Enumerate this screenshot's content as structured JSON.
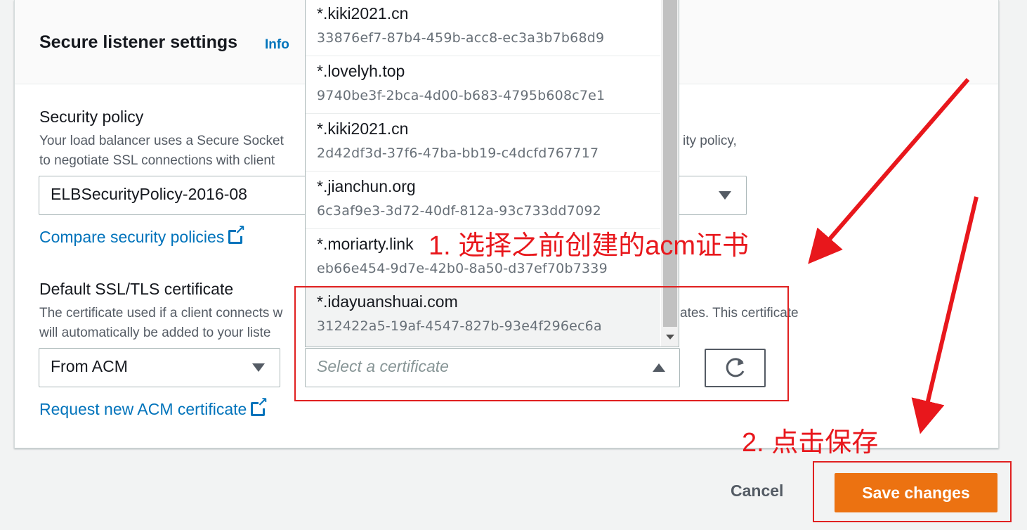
{
  "section": {
    "title": "Secure listener settings",
    "info_label": "Info"
  },
  "security_policy": {
    "label": "Security policy",
    "desc_line1": "Your load balancer uses a Secure Socket",
    "desc_line1_tail": "ity policy,",
    "desc_line2": "to negotiate SSL connections with client",
    "value": "ELBSecurityPolicy-2016-08",
    "compare_link": "Compare security policies"
  },
  "certificate": {
    "label": "Default SSL/TLS certificate",
    "desc_line1": "The certificate used if a client connects w",
    "desc_line1_tail": "ates. This certificate",
    "desc_line2": "will automatically be added to your liste",
    "source_value": "From ACM",
    "select_placeholder": "Select a certificate",
    "request_link": "Request new ACM certificate",
    "options": [
      {
        "name": "*.kiki2021.cn",
        "id": "33876ef7-87b4-459b-acc8-ec3a3b7b68d9"
      },
      {
        "name": "*.lovelyh.top",
        "id": "9740be3f-2bca-4d00-b683-4795b608c7e1"
      },
      {
        "name": "*.kiki2021.cn",
        "id": "2d42df3d-37f6-47ba-bb19-c4dcfd767717"
      },
      {
        "name": "*.jianchun.org",
        "id": "6c3af9e3-3d72-40df-812a-93c733dd7092"
      },
      {
        "name": "*.moriarty.link",
        "id": "eb66e454-9d7e-42b0-8a50-d37ef70b7339"
      },
      {
        "name": "*.idayuanshuai.com",
        "id": "312422a5-19af-4547-827b-93e4f296ec6a"
      }
    ]
  },
  "actions": {
    "cancel": "Cancel",
    "save": "Save changes"
  },
  "annotations": {
    "step1": "1. 选择之前创建的acm证书",
    "step2": "2. 点击保存"
  },
  "colors": {
    "accent": "#ec7211",
    "link": "#0073bb",
    "annotation": "#e8171c"
  }
}
